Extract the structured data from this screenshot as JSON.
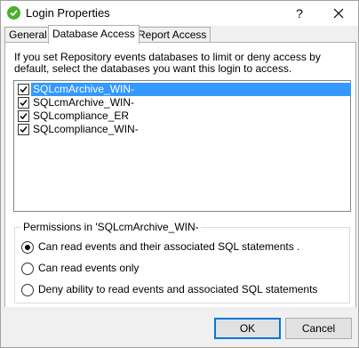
{
  "window": {
    "title": "Login Properties",
    "help_label": "?",
    "icons": {
      "app": "check-circle-icon",
      "close": "close-icon"
    }
  },
  "tabs": [
    {
      "label": "General",
      "active": false
    },
    {
      "label": "Database Access",
      "active": true
    },
    {
      "label": "Report Access",
      "active": false
    }
  ],
  "database_access": {
    "intro": "If you set Repository events databases to limit or deny access by default, select the databases you want this login to access.",
    "databases": [
      {
        "label": "SQLcmArchive_WIN-",
        "checked": true,
        "selected": true
      },
      {
        "label": "SQLcmArchive_WIN-",
        "checked": true,
        "selected": false
      },
      {
        "label": "SQLcompliance_ER",
        "checked": true,
        "selected": false
      },
      {
        "label": "SQLcompliance_WIN-",
        "checked": true,
        "selected": false
      }
    ],
    "permissions": {
      "legend": "Permissions in 'SQLcmArchive_WIN-",
      "options": [
        {
          "label": "Can read events and their associated SQL statements .",
          "checked": true
        },
        {
          "label": "Can read events only",
          "checked": false
        },
        {
          "label": "Deny ability to read events and associated SQL statements",
          "checked": false
        }
      ]
    }
  },
  "buttons": {
    "ok": "OK",
    "cancel": "Cancel"
  },
  "colors": {
    "selection": "#3399ff",
    "app_icon": "#4caf2e",
    "default_button_border": "#0078d7"
  }
}
